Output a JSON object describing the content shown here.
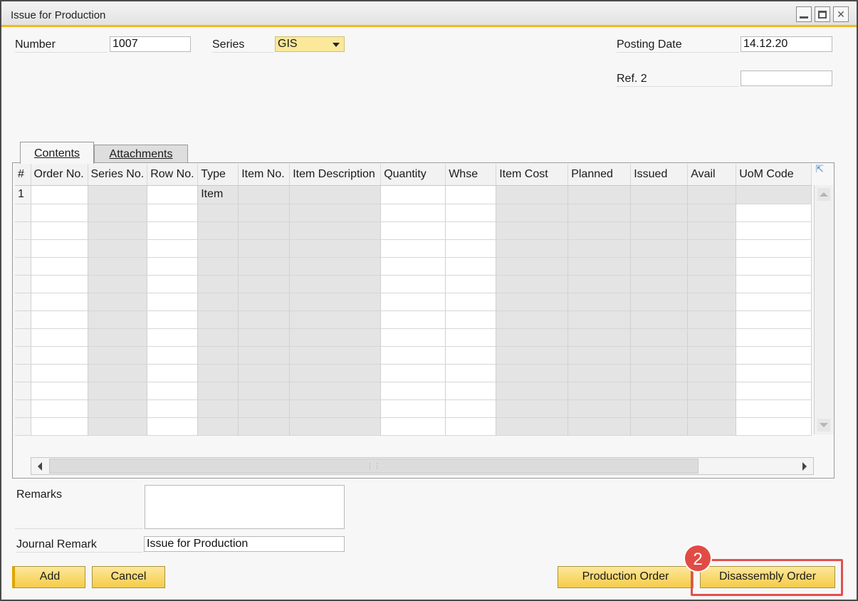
{
  "window": {
    "title": "Issue for Production"
  },
  "header": {
    "number_label": "Number",
    "number_value": "1007",
    "series_label": "Series",
    "series_value": "GIS",
    "posting_date_label": "Posting Date",
    "posting_date_value": "14.12.20",
    "ref2_label": "Ref. 2",
    "ref2_value": ""
  },
  "tabs": [
    {
      "label": "Contents"
    },
    {
      "label": "Attachments"
    }
  ],
  "grid": {
    "columns": [
      "#",
      "Order No.",
      "Series No.",
      "Row No.",
      "Type",
      "Item No.",
      "Item Description",
      "Quantity",
      "Whse",
      "Item Cost",
      "Planned",
      "Issued",
      "Avail",
      "UoM Code"
    ],
    "rows": [
      {
        "num": "1",
        "type": "Item"
      }
    ]
  },
  "footer": {
    "remarks_label": "Remarks",
    "remarks_value": "",
    "journal_remark_label": "Journal Remark",
    "journal_remark_value": "Issue for Production"
  },
  "buttons": {
    "add": "Add",
    "cancel": "Cancel",
    "production_order": "Production Order",
    "disassembly_order": "Disassembly Order"
  },
  "annotation": {
    "step": "2"
  },
  "colors": {
    "accent": "#f2b81a",
    "button": "#f5cc4a",
    "highlight": "#e2504f"
  }
}
